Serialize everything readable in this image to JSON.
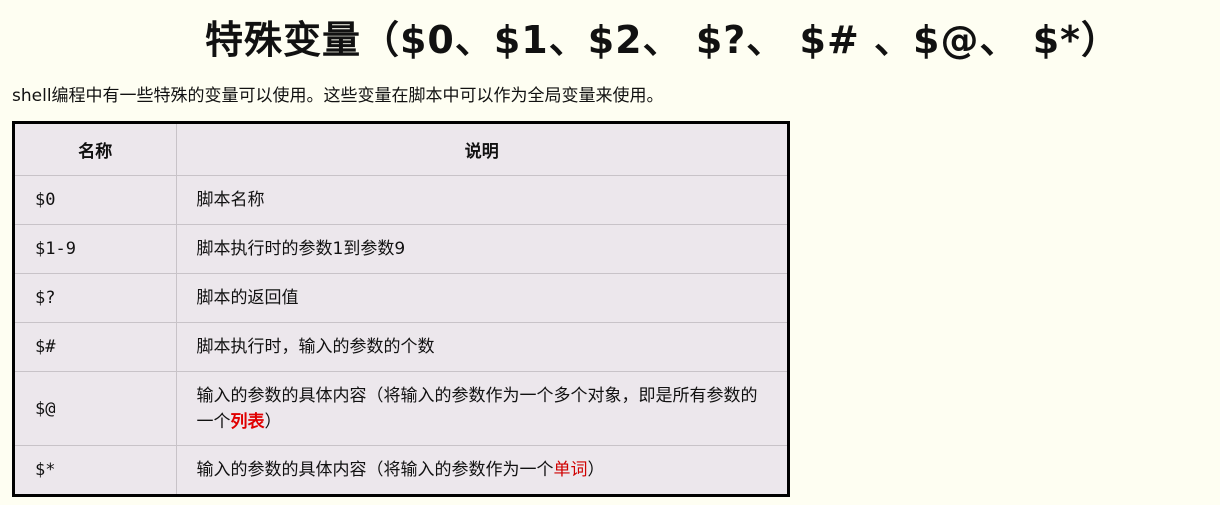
{
  "title": "特殊变量（$0、$1、$2、 $?、 $# 、$@、 $*）",
  "intro": "shell编程中有一些特殊的变量可以使用。这些变量在脚本中可以作为全局变量来使用。",
  "table": {
    "headers": [
      "名称",
      "说明"
    ],
    "rows": [
      {
        "name": "$0",
        "desc": "脚本名称"
      },
      {
        "name": "$1-9",
        "desc": "脚本执行时的参数1到参数9"
      },
      {
        "name": "$?",
        "desc": "脚本的返回值"
      },
      {
        "name": "$#",
        "desc": "脚本执行时，输入的参数的个数"
      },
      {
        "name": "$@",
        "desc": "输入的参数的具体内容（将输入的参数作为一个多个对象，即是所有参数的一个",
        "highlight": "列表",
        "desc_end": "）"
      },
      {
        "name": "$*",
        "desc": "输入的参数的具体内容（将输入的参数作为一个",
        "highlight": "单词",
        "desc_end": "）"
      }
    ]
  },
  "colors": {
    "background": "#fefef2",
    "table_bg": "#ece7ec",
    "highlight": "#e00000"
  }
}
